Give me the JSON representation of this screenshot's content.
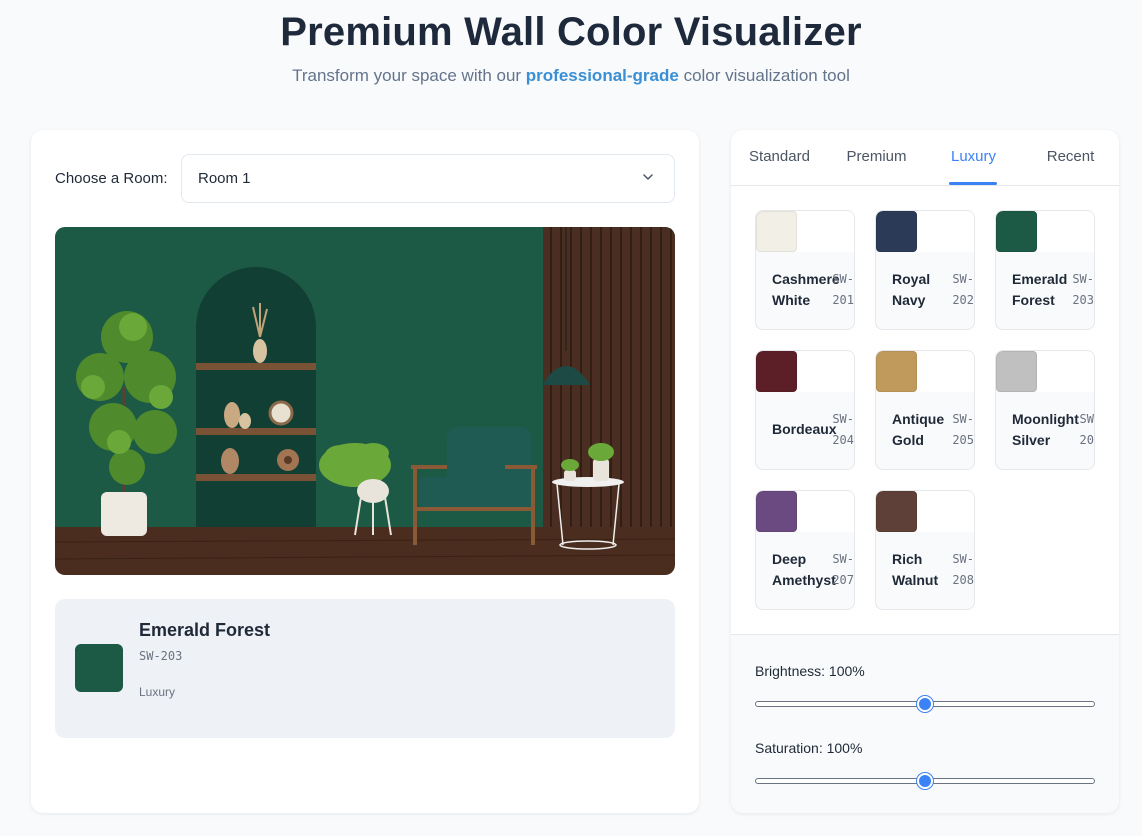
{
  "header": {
    "title": "Premium Wall Color Visualizer",
    "subtitle_before": "Transform your space with our ",
    "subtitle_highlight": "professional-grade",
    "subtitle_after": " color visualization tool"
  },
  "room_selector": {
    "label": "Choose a Room:",
    "selected": "Room 1"
  },
  "preview": {
    "wall_color": "#1c5a45"
  },
  "selected_color": {
    "name": "Emerald Forest",
    "code": "SW-203",
    "category": "Luxury",
    "hex": "#1c5a45"
  },
  "tabs": [
    {
      "label": "Standard",
      "active": false
    },
    {
      "label": "Premium",
      "active": false
    },
    {
      "label": "Luxury",
      "active": true
    },
    {
      "label": "Recent",
      "active": false
    }
  ],
  "palette": [
    {
      "name_line1": "Cashmere",
      "name_line2": "White",
      "code_line1": "SW-",
      "code_line2": "201",
      "hex": "#f2efe6"
    },
    {
      "name_line1": "Royal",
      "name_line2": "Navy",
      "code_line1": "SW-",
      "code_line2": "202",
      "hex": "#2b3a57"
    },
    {
      "name_line1": "Emerald",
      "name_line2": "Forest",
      "code_line1": "SW-",
      "code_line2": "203",
      "hex": "#1c5a45"
    },
    {
      "name_line1": "Bordeaux",
      "name_line2": "",
      "code_line1": "SW-",
      "code_line2": "204",
      "hex": "#5c1f28"
    },
    {
      "name_line1": "Antique",
      "name_line2": "Gold",
      "code_line1": "SW-",
      "code_line2": "205",
      "hex": "#bf9a5c"
    },
    {
      "name_line1": "Moonlight",
      "name_line2": "Silver",
      "code_line1": "SW",
      "code_line2": "20",
      "hex": "#c0c0c0"
    },
    {
      "name_line1": "Deep",
      "name_line2": "Amethyst",
      "code_line1": "SW-",
      "code_line2": "207",
      "hex": "#6a4a80"
    },
    {
      "name_line1": "Rich",
      "name_line2": "Walnut",
      "code_line1": "SW-",
      "code_line2": "208",
      "hex": "#5e4038"
    }
  ],
  "adjustments": {
    "brightness_label": "Brightness: 100%",
    "brightness_value": 100,
    "saturation_label": "Saturation: 100%",
    "saturation_value": 100
  }
}
